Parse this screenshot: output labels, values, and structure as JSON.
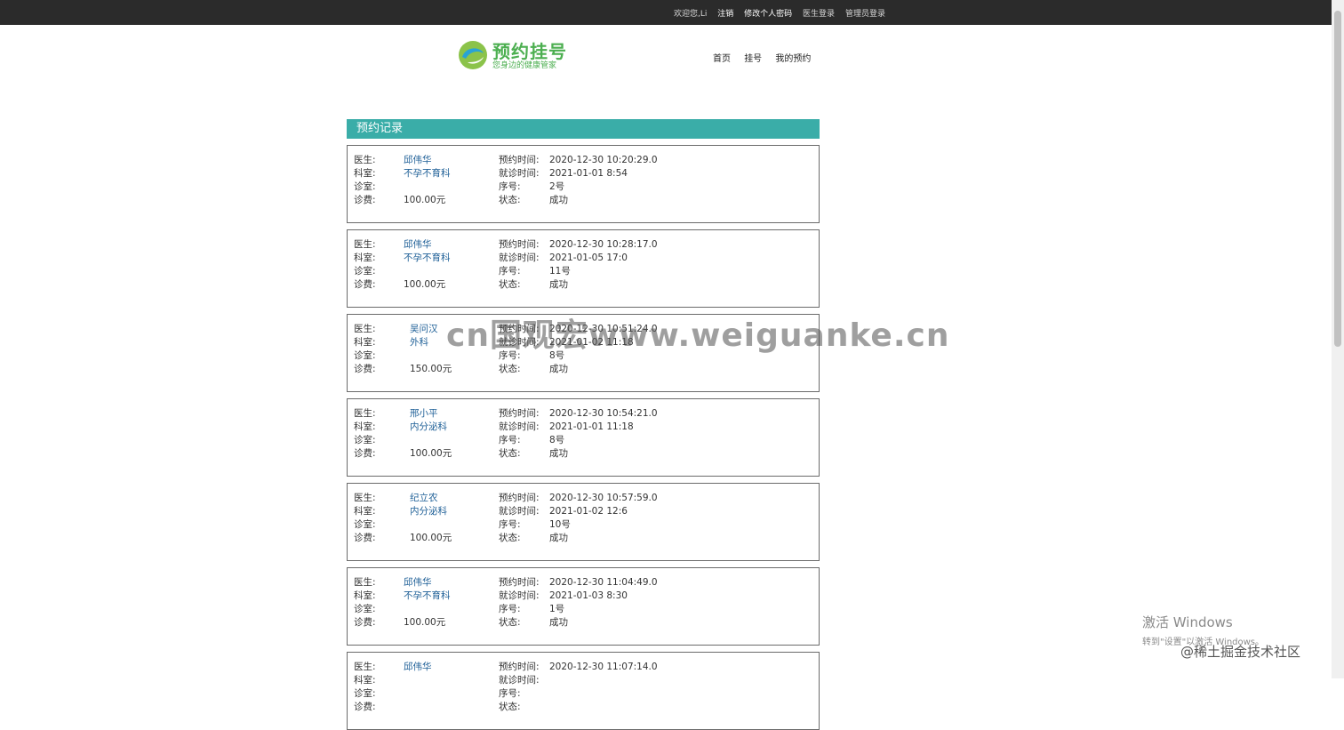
{
  "topbar": {
    "welcome": "欢迎您,Li",
    "logout": "注销",
    "change_password": "修改个人密码",
    "doctor_login": "医生登录",
    "admin_login": "管理员登录"
  },
  "logo": {
    "title": "预约挂号",
    "subtitle": "您身边的健康管家"
  },
  "nav": {
    "home": "首页",
    "register": "挂号",
    "my_appointments": "我的预约"
  },
  "section_title": "预约记录",
  "labels": {
    "doctor": "医生:",
    "department": "科室:",
    "room": "诊室:",
    "fee": "诊费:",
    "booking_time": "预约时间:",
    "visit_time": "就诊时间:",
    "number": "序号:",
    "status": "状态:"
  },
  "records": [
    {
      "doctor": "邱伟华",
      "department": "不孕不育科",
      "room": "",
      "fee": "100.00元",
      "booking_time": "2020-12-30 10:20:29.0",
      "visit_time": "2021-01-01 8:54",
      "number": "2号",
      "status": "成功"
    },
    {
      "doctor": "邱伟华",
      "department": "不孕不育科",
      "room": "",
      "fee": "100.00元",
      "booking_time": "2020-12-30 10:28:17.0",
      "visit_time": "2021-01-05 17:0",
      "number": "11号",
      "status": "成功"
    },
    {
      "doctor": "吴问汉",
      "department": "外科",
      "room": "",
      "fee": "150.00元",
      "booking_time": "2020-12-30 10:51:24.0",
      "visit_time": "2021-01-02 11:18",
      "number": "8号",
      "status": "成功"
    },
    {
      "doctor": "邢小平",
      "department": "内分泌科",
      "room": "",
      "fee": "100.00元",
      "booking_time": "2020-12-30 10:54:21.0",
      "visit_time": "2021-01-01 11:18",
      "number": "8号",
      "status": "成功"
    },
    {
      "doctor": "纪立农",
      "department": "内分泌科",
      "room": "",
      "fee": "100.00元",
      "booking_time": "2020-12-30 10:57:59.0",
      "visit_time": "2021-01-02 12:6",
      "number": "10号",
      "status": "成功"
    },
    {
      "doctor": "邱伟华",
      "department": "不孕不育科",
      "room": "",
      "fee": "100.00元",
      "booking_time": "2020-12-30 11:04:49.0",
      "visit_time": "2021-01-03 8:30",
      "number": "1号",
      "status": "成功"
    },
    {
      "doctor": "邱伟华",
      "department": "",
      "room": "",
      "fee": "",
      "booking_time": "2020-12-30 11:07:14.0",
      "visit_time": "",
      "number": "",
      "status": ""
    }
  ],
  "overlay": {
    "watermark": "cn国观宏www.weiguanke.cn",
    "activate_title": "激活 Windows",
    "activate_sub": "转到\"设置\"以激活 Windows。",
    "community": "@稀土掘金技术社区"
  },
  "colors": {
    "topbar_bg": "#2b2b2b",
    "section_header_bg": "#3aada8",
    "link_blue": "#1c5e96",
    "logo_green": "#4caf50"
  }
}
